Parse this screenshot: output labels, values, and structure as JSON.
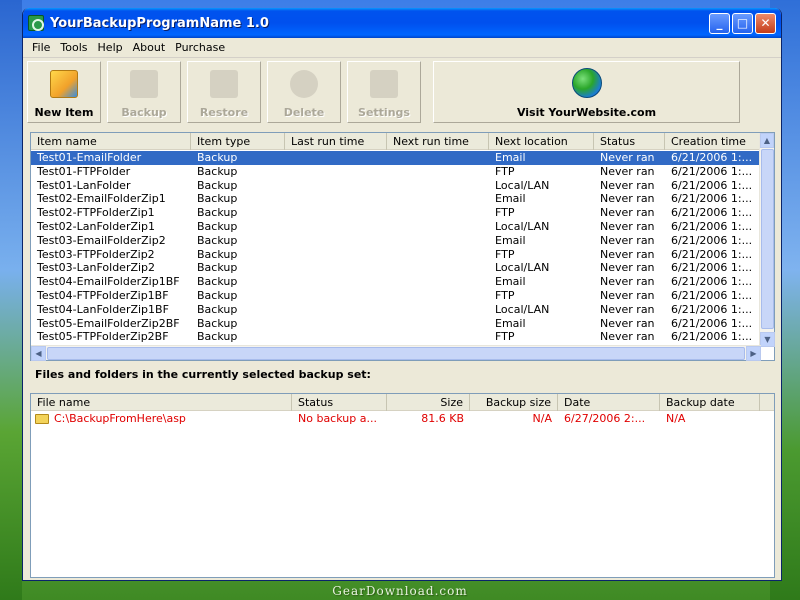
{
  "window": {
    "title": "YourBackupProgramName 1.0",
    "controls": {
      "minimize": "_",
      "maximize": "□",
      "close": "✕"
    }
  },
  "menu": [
    "File",
    "Tools",
    "Help",
    "About",
    "Purchase"
  ],
  "toolbar": {
    "new_item": "New Item",
    "backup": "Backup",
    "restore": "Restore",
    "delete": "Delete",
    "settings": "Settings",
    "visit": "Visit YourWebsite.com"
  },
  "grid": {
    "columns": [
      "Item name",
      "Item type",
      "Last run time",
      "Next run time",
      "Next location",
      "Status",
      "Creation time"
    ],
    "rows": [
      {
        "name": "Test01-EmailFolder",
        "type": "Backup",
        "last": "",
        "next": "",
        "loc": "Email",
        "status": "Never ran",
        "created": "6/21/2006 1:..."
      },
      {
        "name": "Test01-FTPFolder",
        "type": "Backup",
        "last": "",
        "next": "",
        "loc": "FTP",
        "status": "Never ran",
        "created": "6/21/2006 1:..."
      },
      {
        "name": "Test01-LanFolder",
        "type": "Backup",
        "last": "",
        "next": "",
        "loc": "Local/LAN",
        "status": "Never ran",
        "created": "6/21/2006 1:..."
      },
      {
        "name": "Test02-EmailFolderZip1",
        "type": "Backup",
        "last": "",
        "next": "",
        "loc": "Email",
        "status": "Never ran",
        "created": "6/21/2006 1:..."
      },
      {
        "name": "Test02-FTPFolderZip1",
        "type": "Backup",
        "last": "",
        "next": "",
        "loc": "FTP",
        "status": "Never ran",
        "created": "6/21/2006 1:..."
      },
      {
        "name": "Test02-LanFolderZip1",
        "type": "Backup",
        "last": "",
        "next": "",
        "loc": "Local/LAN",
        "status": "Never ran",
        "created": "6/21/2006 1:..."
      },
      {
        "name": "Test03-EmailFolderZip2",
        "type": "Backup",
        "last": "",
        "next": "",
        "loc": "Email",
        "status": "Never ran",
        "created": "6/21/2006 1:..."
      },
      {
        "name": "Test03-FTPFolderZip2",
        "type": "Backup",
        "last": "",
        "next": "",
        "loc": "FTP",
        "status": "Never ran",
        "created": "6/21/2006 1:..."
      },
      {
        "name": "Test03-LanFolderZip2",
        "type": "Backup",
        "last": "",
        "next": "",
        "loc": "Local/LAN",
        "status": "Never ran",
        "created": "6/21/2006 1:..."
      },
      {
        "name": "Test04-EmailFolderZip1BF",
        "type": "Backup",
        "last": "",
        "next": "",
        "loc": "Email",
        "status": "Never ran",
        "created": "6/21/2006 1:..."
      },
      {
        "name": "Test04-FTPFolderZip1BF",
        "type": "Backup",
        "last": "",
        "next": "",
        "loc": "FTP",
        "status": "Never ran",
        "created": "6/21/2006 1:..."
      },
      {
        "name": "Test04-LanFolderZip1BF",
        "type": "Backup",
        "last": "",
        "next": "",
        "loc": "Local/LAN",
        "status": "Never ran",
        "created": "6/21/2006 1:..."
      },
      {
        "name": "Test05-EmailFolderZip2BF",
        "type": "Backup",
        "last": "",
        "next": "",
        "loc": "Email",
        "status": "Never ran",
        "created": "6/21/2006 1:..."
      },
      {
        "name": "Test05-FTPFolderZip2BF",
        "type": "Backup",
        "last": "",
        "next": "",
        "loc": "FTP",
        "status": "Never ran",
        "created": "6/21/2006 1:..."
      }
    ],
    "selected_index": 0
  },
  "files_section": {
    "label": "Files and folders in the currently selected backup set:",
    "columns": [
      "File name",
      "Status",
      "Size",
      "Backup size",
      "Date",
      "Backup date"
    ],
    "rows": [
      {
        "name": "C:\\BackupFromHere\\asp",
        "status": "No backup a...",
        "size": "81.6 KB",
        "backup_size": "N/A",
        "date": "6/27/2006 2:...",
        "backup_date": "N/A"
      }
    ]
  },
  "watermark": "GearDownload.com",
  "colors": {
    "title_blue": "#0053ee",
    "selection": "#316ac5",
    "file_red": "#e00000",
    "face": "#ece9d8"
  }
}
